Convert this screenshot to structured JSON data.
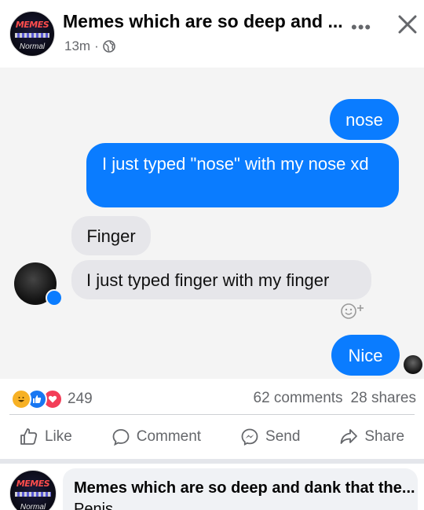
{
  "post": {
    "page_name": "Memes which are so deep and ...",
    "time": "13m",
    "separator": "·",
    "more_label": "•••",
    "avatar_top": "MEMES",
    "avatar_bottom": "Normal"
  },
  "chat": {
    "messages": [
      {
        "text": "nose",
        "side": "outgoing"
      },
      {
        "text": "I just typed \"nose\" with my nose xd",
        "side": "outgoing"
      },
      {
        "text": "Finger",
        "side": "incoming"
      },
      {
        "text": "I just typed finger with my finger",
        "side": "incoming"
      },
      {
        "text": "Nice",
        "side": "outgoing"
      }
    ],
    "colors": {
      "outgoing": "#0a7cff",
      "incoming": "#e6e6ea",
      "background": "#f4f4f4"
    }
  },
  "stats": {
    "reaction_count": "249",
    "comments": "62 comments",
    "shares": "28 shares",
    "reactions": [
      "haha-icon",
      "like-icon",
      "love-icon"
    ]
  },
  "actions": {
    "like": "Like",
    "comment": "Comment",
    "send": "Send",
    "share": "Share"
  },
  "shared_post": {
    "title": "Memes which are so deep and dank that the...",
    "text": "Penis"
  }
}
